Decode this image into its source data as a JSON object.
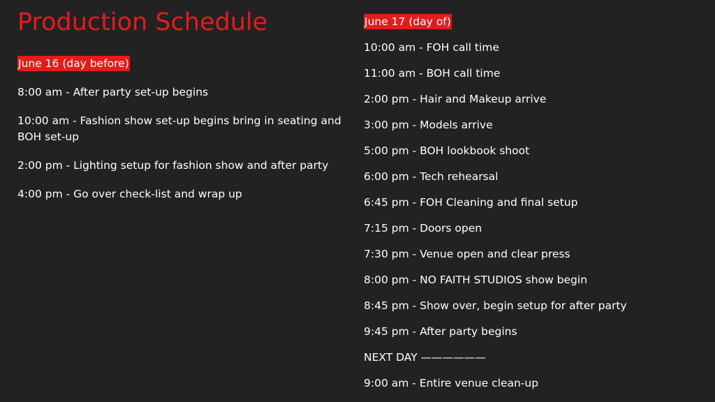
{
  "title": "Production Schedule",
  "colors": {
    "background": "#222222",
    "accent": "#e31c1c",
    "text": "#ffffff"
  },
  "day_before": {
    "label": "June 16 (day before)",
    "items": [
      "8:00 am - After party set-up begins",
      "10:00 am - Fashion show set-up begins bring in seating and BOH set-up",
      "2:00 pm - Lighting setup for fashion show and after party",
      "4:00 pm - Go over check-list and wrap up"
    ]
  },
  "day_of": {
    "label": "June 17 (day of)",
    "items": [
      "10:00 am - FOH call time",
      "11:00 am - BOH call time",
      "2:00 pm - Hair and Makeup arrive",
      "3:00 pm - Models arrive",
      "5:00 pm - BOH lookbook shoot",
      "6:00 pm - Tech rehearsal",
      "6:45 pm - FOH Cleaning and final setup",
      "7:15 pm - Doors open",
      "7:30 pm - Venue open and clear press",
      "8:00 pm - NO FAITH STUDIOS show begin",
      "8:45 pm - Show over, begin setup for after party",
      "9:45 pm - After party begins",
      "NEXT DAY ——————",
      "9:00 am - Entire venue clean-up"
    ]
  }
}
